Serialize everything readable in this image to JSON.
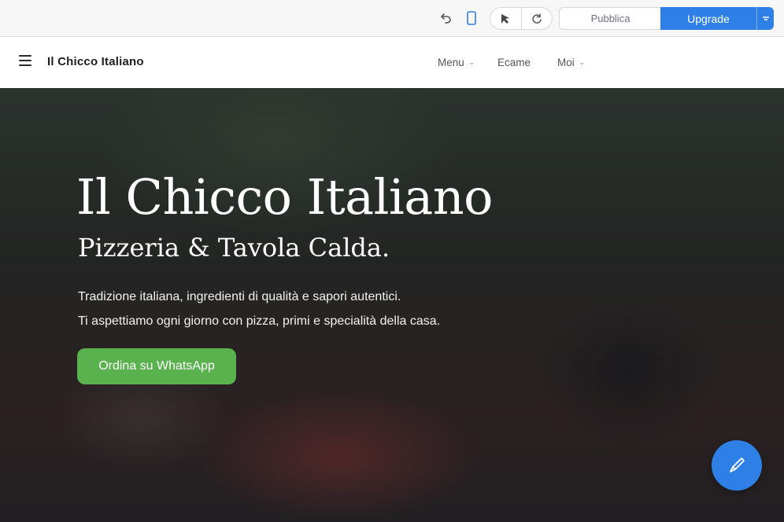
{
  "editor_toolbar": {
    "publish_label": "Pubblica",
    "upgrade_label": "Upgrade"
  },
  "site_nav": {
    "brand": "Il Chicco Italiano",
    "items": [
      {
        "label": "Menu",
        "has_dropdown": true
      },
      {
        "label": "Ecame",
        "has_dropdown": false
      },
      {
        "label": "Moi",
        "has_dropdown": true
      }
    ]
  },
  "hero": {
    "title": "Il Chicco Italiano",
    "subtitle": "Pizzeria & Tavola Calda.",
    "line1": "Tradizione italiana, ingredienti di qualità e sapori autentici.",
    "line2": "Ti aspettiamo ogni giorno con pizza, primi e specialità della casa.",
    "cta_label": "Ordina su WhatsApp"
  },
  "colors": {
    "accent": "#2f80e6",
    "cta": "#5ab24f"
  }
}
